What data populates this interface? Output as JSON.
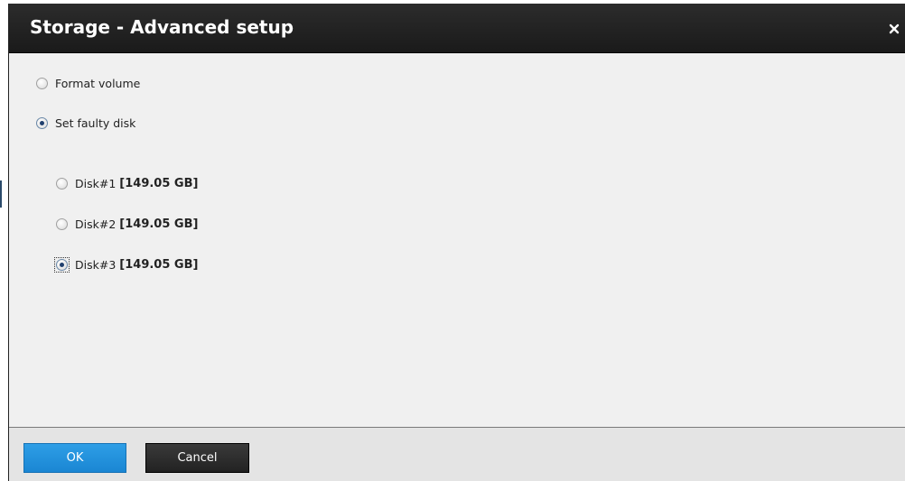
{
  "dialog": {
    "title": "Storage - Advanced setup",
    "close_glyph": "×"
  },
  "options": {
    "format_volume": {
      "label": "Format volume",
      "checked": false
    },
    "set_faulty_disk": {
      "label": "Set faulty disk",
      "checked": true
    }
  },
  "disks": [
    {
      "label": "Disk#1",
      "size": "[149.05 GB]",
      "checked": false
    },
    {
      "label": "Disk#2",
      "size": "[149.05 GB]",
      "checked": false
    },
    {
      "label": "Disk#3",
      "size": "[149.05 GB]",
      "checked": true
    }
  ],
  "footer": {
    "ok_label": "OK",
    "cancel_label": "Cancel"
  },
  "colors": {
    "title_bar": "#222222",
    "ok_button": "#1a86d3",
    "cancel_button": "#2a2a2a",
    "content_bg": "#f0f0f0"
  }
}
